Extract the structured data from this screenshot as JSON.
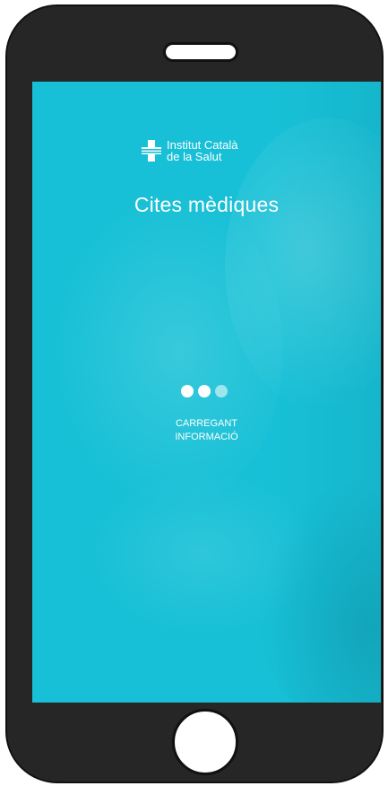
{
  "app": {
    "logo_line1": "Institut Català",
    "logo_line2": "de la Salut",
    "title": "Cites mèdiques"
  },
  "loading": {
    "line1": "CARREGANT",
    "line2": "INFORMACIÓ",
    "dots_total": 3,
    "dots_active": 2
  },
  "colors": {
    "screen_background": "#17c0d6",
    "device_body": "#262626",
    "text": "#ffffff"
  },
  "icons": {
    "logo": "health-cross-icon",
    "loader": "loading-dots-icon"
  }
}
